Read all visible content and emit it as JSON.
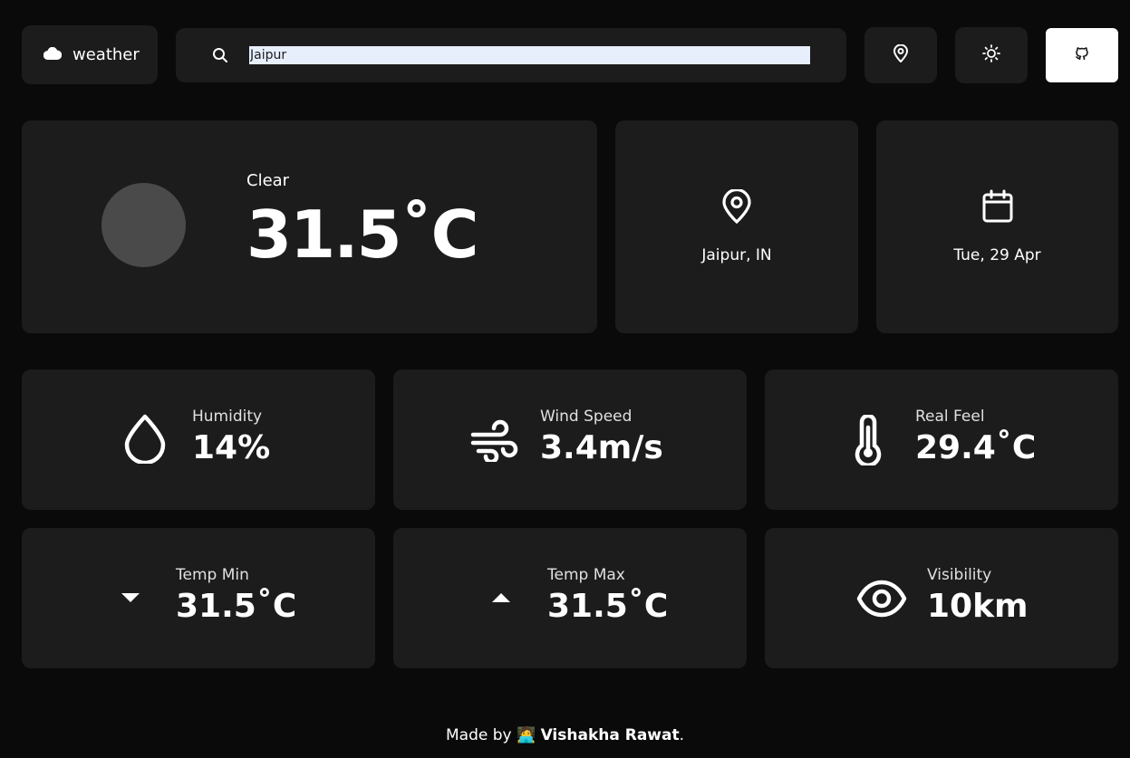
{
  "header": {
    "logo_text": "weather",
    "search_value": "Jaipur",
    "icons": [
      "cloud-icon",
      "search-icon",
      "location-pin-icon",
      "sun-icon",
      "github-icon"
    ]
  },
  "current": {
    "condition": "Clear",
    "temperature": "31.5˚C",
    "location": "Jaipur, IN",
    "date": "Tue, 29 Apr"
  },
  "stats": {
    "humidity": {
      "label": "Humidity",
      "value": "14%"
    },
    "wind": {
      "label": "Wind Speed",
      "value": "3.4m/s"
    },
    "real_feel": {
      "label": "Real Feel",
      "value": "29.4˚C"
    },
    "temp_min": {
      "label": "Temp Min",
      "value": "31.5˚C"
    },
    "temp_max": {
      "label": "Temp Max",
      "value": "31.5˚C"
    },
    "visibility": {
      "label": "Visibility",
      "value": "10km"
    }
  },
  "footer": {
    "prefix": "Made by",
    "emoji": "🧑‍💻",
    "author": "Vishakha Rawat",
    "suffix": "."
  },
  "colors": {
    "background": "#0a0a0a",
    "card": "#1c1c1c",
    "orb": "#4a4a4a",
    "search_highlight": "#e7eefc"
  }
}
